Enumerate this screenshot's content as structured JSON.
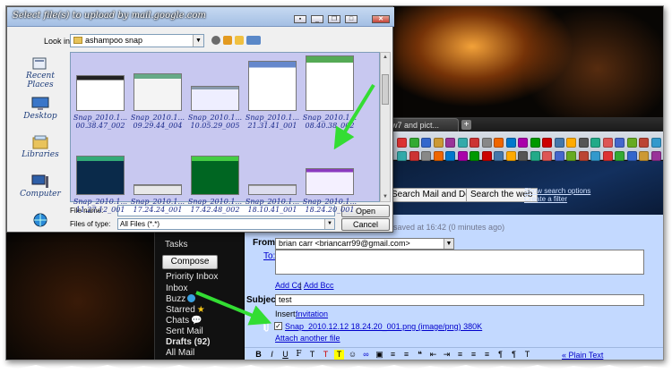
{
  "dialog": {
    "title": "Select file(s) to upload by mail.google.com",
    "lookin_label": "Look in:",
    "lookin_value": "ashampoo snap",
    "places": [
      "Recent Places",
      "Desktop",
      "Libraries",
      "Computer",
      ""
    ],
    "files": [
      {
        "name": "Snap_2010.1... 00.38.47_002"
      },
      {
        "name": "Snap_2010.1... 09.29.44_004"
      },
      {
        "name": "Snap_2010.1... 10.05.29_005"
      },
      {
        "name": "Snap_2010.1... 21.31.41_001"
      },
      {
        "name": "Snap_2010.1... 08.40.38_002"
      },
      {
        "name": "Snap_2010.1... 11.27.12_001"
      },
      {
        "name": "Snap_2010.1... 17.24.24_001"
      },
      {
        "name": "Snap_2010.1... 17.42.48_002"
      },
      {
        "name": "Snap_2010.1... 18.10.41_001"
      },
      {
        "name": "Snap_2010.1... 18.24.20_001"
      }
    ],
    "filename_label": "File name:",
    "filename_value": "",
    "filetype_label": "Files of type:",
    "filetype_value": "All Files (*.*)",
    "open_label": "Open",
    "cancel_label": "Cancel"
  },
  "browser": {
    "tab_title": "w7 and pict...",
    "newtab": "+",
    "search_mail_label": "Search Mail and Docs",
    "search_web_label": "Search the web",
    "search_options": "Show search options",
    "create_filter": "Create a filter"
  },
  "gmail": {
    "tasks": "Tasks",
    "compose": "Compose mail",
    "nav": [
      "Priority Inbox",
      "Inbox",
      "Buzz",
      "Starred",
      "Chats",
      "Sent Mail",
      "Drafts (92)",
      "All Mail"
    ],
    "saved_status": "saved at 16:42 (0 minutes ago)",
    "from_label": "From:",
    "from_value": "brian carr <briancarr99@gmail.com>",
    "to_label": "To:",
    "add_cc": "Add Cc",
    "add_bcc": "Add Bcc",
    "subject_label": "Subject:",
    "subject_value": "test",
    "insert_label": "Insert:",
    "invitation": "Invitation",
    "attached_file": "Snap_2010.12.12 18.24.20_001.png (image/png) 380K",
    "attach_another": "Attach another file",
    "plain_text": "« Plain Text"
  },
  "colors": {
    "arrow": "#33dd33",
    "dialog_list": "#c8c8f0",
    "compose_bg": "#c3d9ff"
  }
}
